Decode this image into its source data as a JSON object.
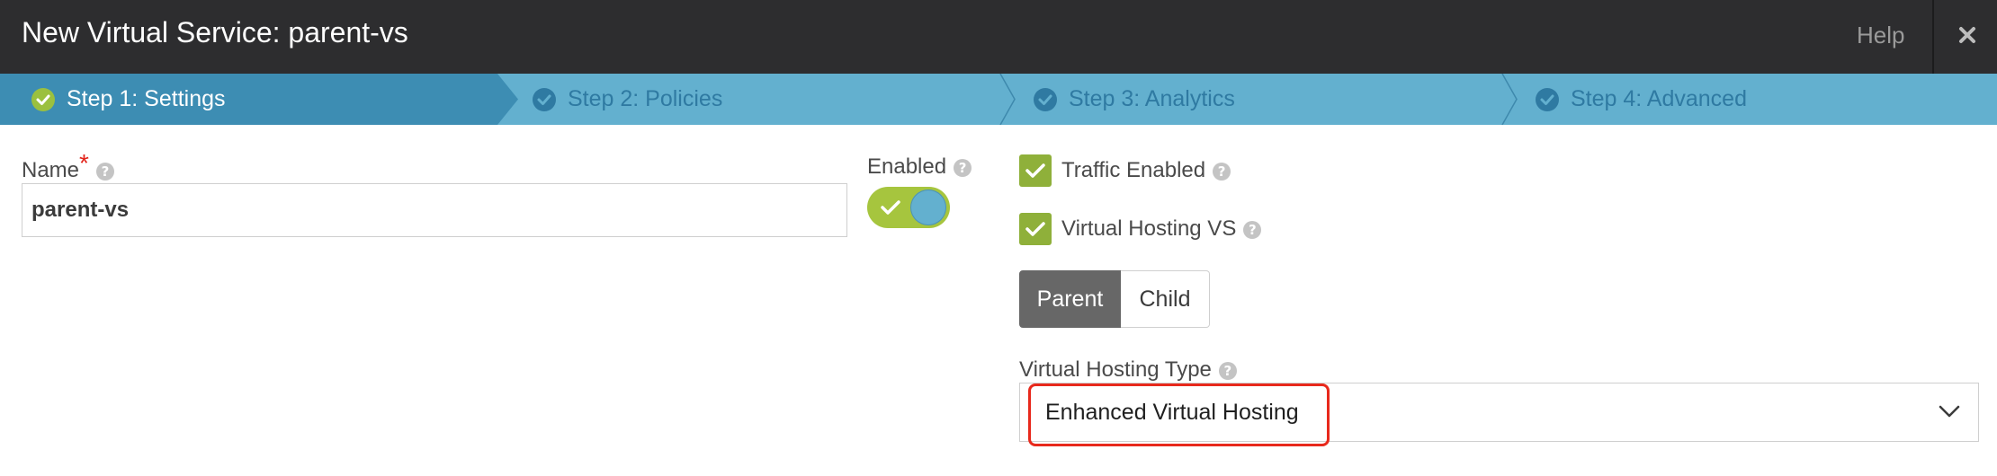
{
  "header": {
    "title": "New Virtual Service: parent-vs",
    "help_label": "Help",
    "close_icon": "close-icon"
  },
  "steps": [
    {
      "label": "Step 1: Settings",
      "active": true
    },
    {
      "label": "Step 2: Policies",
      "active": false
    },
    {
      "label": "Step 3: Analytics",
      "active": false
    },
    {
      "label": "Step 4: Advanced",
      "active": false
    }
  ],
  "form": {
    "name_label": "Name",
    "required_mark": "*",
    "name_value": "parent-vs",
    "enabled_label": "Enabled",
    "enabled_on": true,
    "traffic_enabled_label": "Traffic Enabled",
    "traffic_enabled_checked": true,
    "virtual_hosting_label": "Virtual Hosting VS",
    "virtual_hosting_checked": true,
    "segment": {
      "parent_label": "Parent",
      "child_label": "Child",
      "selected": "Parent"
    },
    "vh_type_label": "Virtual Hosting Type",
    "vh_type_value": "Enhanced Virtual Hosting",
    "help_glyph": "?"
  },
  "colors": {
    "header_bg": "#2d2d2f",
    "steps_bg": "#63b0cf",
    "active_step_bg": "#3d8db3",
    "check_green": "#8fb03a",
    "toggle_green": "#a6c53e",
    "highlight_red": "#e8291c"
  }
}
